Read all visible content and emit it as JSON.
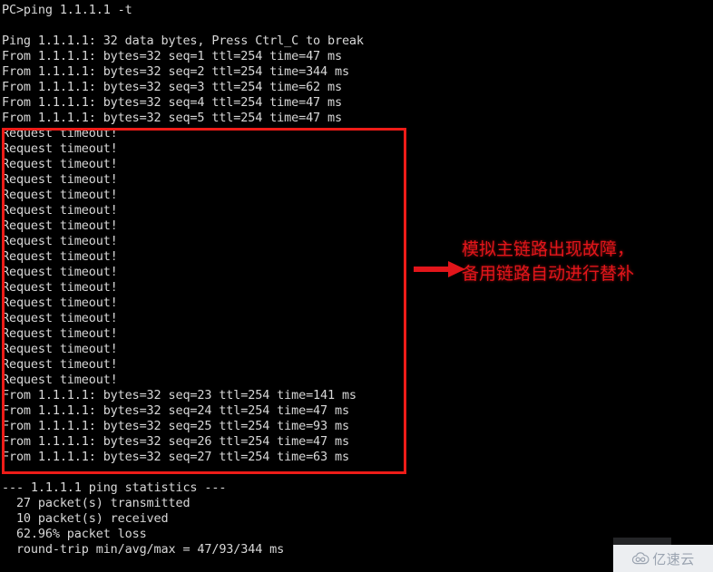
{
  "terminal": {
    "background_color": "#000000",
    "text_color": "#d8d8d8",
    "prompt_line": "PC>ping 1.1.1.1 -t",
    "blank_line": "",
    "header_line": "Ping 1.1.1.1: 32 data bytes, Press Ctrl_C to break",
    "replies_before": [
      "From 1.1.1.1: bytes=32 seq=1 ttl=254 time=47 ms",
      "From 1.1.1.1: bytes=32 seq=2 ttl=254 time=344 ms",
      "From 1.1.1.1: bytes=32 seq=3 ttl=254 time=62 ms",
      "From 1.1.1.1: bytes=32 seq=4 ttl=254 time=47 ms",
      "From 1.1.1.1: bytes=32 seq=5 ttl=254 time=47 ms"
    ],
    "timeouts": [
      "Request timeout!",
      "Request timeout!",
      "Request timeout!",
      "Request timeout!",
      "Request timeout!",
      "Request timeout!",
      "Request timeout!",
      "Request timeout!",
      "Request timeout!",
      "Request timeout!",
      "Request timeout!",
      "Request timeout!",
      "Request timeout!",
      "Request timeout!",
      "Request timeout!",
      "Request timeout!",
      "Request timeout!"
    ],
    "replies_after": [
      "From 1.1.1.1: bytes=32 seq=23 ttl=254 time=141 ms",
      "From 1.1.1.1: bytes=32 seq=24 ttl=254 time=47 ms",
      "From 1.1.1.1: bytes=32 seq=25 ttl=254 time=93 ms",
      "From 1.1.1.1: bytes=32 seq=26 ttl=254 time=47 ms",
      "From 1.1.1.1: bytes=32 seq=27 ttl=254 time=63 ms"
    ],
    "statistics": {
      "header": "--- 1.1.1.1 ping statistics ---",
      "transmitted": "  27 packet(s) transmitted",
      "received": "  10 packet(s) received",
      "loss": "  62.96% packet loss",
      "round_trip": "  round-trip min/avg/max = 47/93/344 ms"
    }
  },
  "annotation": {
    "color": "#e2151a",
    "arrow_icon": "right-arrow-icon",
    "line1": "模拟主链路出现故障，",
    "line2": "备用链路自动进行替补"
  },
  "highlight": {
    "border_color": "#ee1c18"
  },
  "watermark": {
    "icon": "cloud-icon",
    "text": "亿速云",
    "text_color": "#9aa3b0",
    "background_color": "#eceef1"
  }
}
